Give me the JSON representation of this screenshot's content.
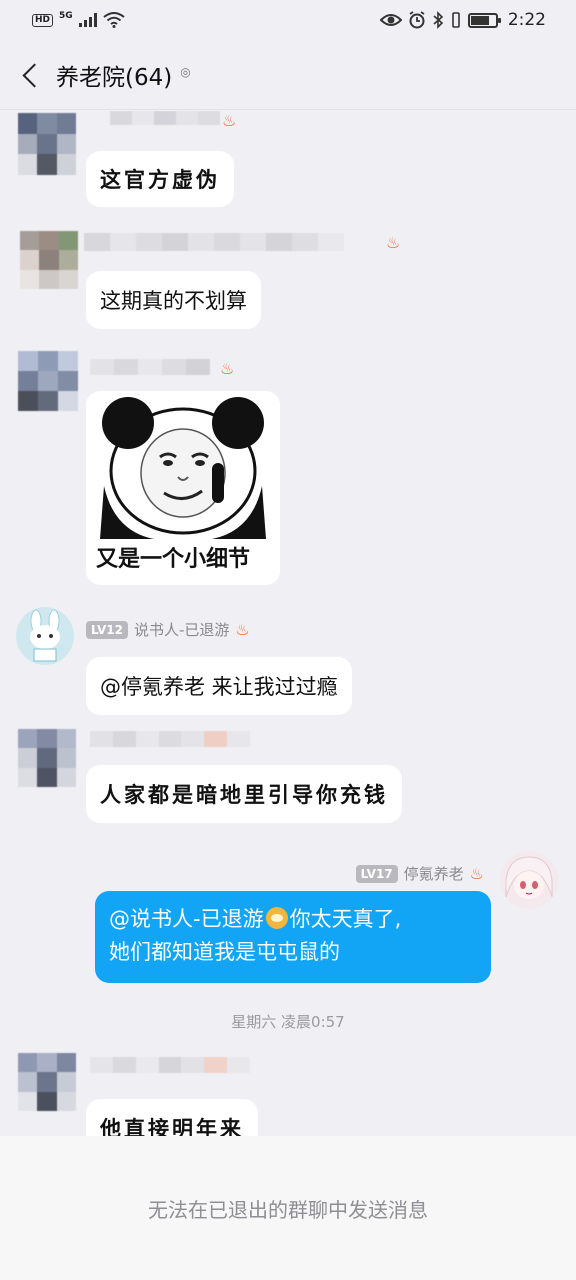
{
  "status_bar": {
    "hd": "HD",
    "network": "5G",
    "time": "2:22",
    "icons": [
      "eye-icon",
      "alarm-icon",
      "bluetooth-icon",
      "battery-icon"
    ]
  },
  "header": {
    "title": "养老院(64)",
    "back_icon": "chevron-left-icon",
    "pin_icon": "pin-icon"
  },
  "messages": [
    {
      "sender": "",
      "text": "这官方虚伪",
      "style": "handwriting"
    },
    {
      "sender": "",
      "text": "这期真的不划算",
      "style": "normal"
    },
    {
      "sender": "",
      "type": "sticker",
      "caption": "又是一个小细节"
    },
    {
      "sender": "说书人-已退游",
      "level": "LV12",
      "text": "@停氪养老 来让我过过瘾"
    },
    {
      "sender": "",
      "text": "人家都是暗地里引导你充钱",
      "style": "handwriting"
    },
    {
      "sender": "停氪养老",
      "level": "LV17",
      "self": true,
      "text_line1_prefix": "@说书人-已退游",
      "text_line1_suffix": "你太天真了,",
      "text_line2": "她们都知道我是屯屯鼠的"
    },
    {
      "sender": "",
      "text": "他直接明年来",
      "style": "handwriting"
    }
  ],
  "time_divider": "星期六 凌晨0:57",
  "footer": {
    "notice": "无法在已退出的群聊中发送消息"
  },
  "colors": {
    "background": "#efeff4",
    "self_bubble": "#12a5f5",
    "level_badge": "#b8b8be",
    "flame": "#f07040"
  }
}
